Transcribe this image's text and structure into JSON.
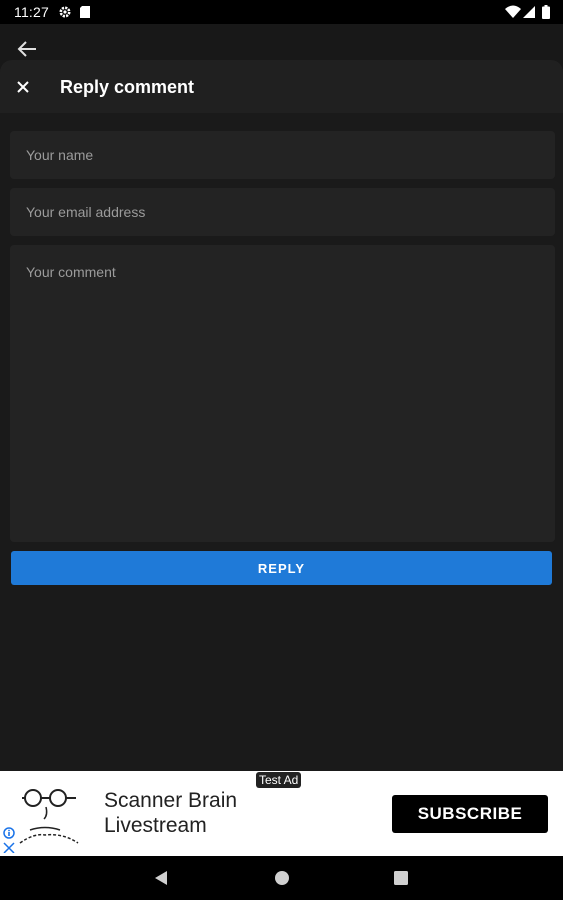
{
  "status_bar": {
    "time": "11:27",
    "left_icons": [
      "gear-icon",
      "sd-card-icon"
    ],
    "right_icons": [
      "wifi-icon",
      "signal-icon",
      "battery-icon"
    ]
  },
  "toolbar": {
    "back_icon": "arrow-left-icon"
  },
  "sheet": {
    "close_icon": "close-icon",
    "title": "Reply comment"
  },
  "form": {
    "name_placeholder": "Your name",
    "email_placeholder": "Your email address",
    "comment_placeholder": "Your comment",
    "reply_label": "REPLY"
  },
  "ad": {
    "tag": "Test Ad",
    "title": "Scanner Brain Livestream",
    "cta": "SUBSCRIBE",
    "image_icon": "cartoon-face-icon",
    "info_icon": "adchoices-icon"
  },
  "nav": {
    "back_icon": "triangle-back-icon",
    "home_icon": "circle-home-icon",
    "recents_icon": "square-recents-icon"
  },
  "colors": {
    "background": "#181818",
    "panel": "#232323",
    "accent": "#1f7ad8"
  }
}
